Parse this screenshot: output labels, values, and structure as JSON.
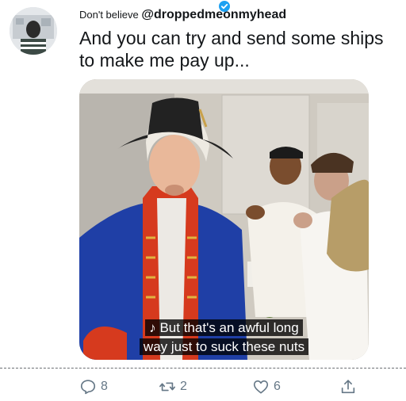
{
  "tweet": {
    "prefix": "Don't believe",
    "handle": "@droppedmeonmyhead",
    "text": "And you can try and send some ships to make me pay up..."
  },
  "video": {
    "caption_line1": "♪ But that's an awful long",
    "caption_line2": "way just to suck these nuts"
  },
  "actions": {
    "reply_count": "8",
    "retweet_count": "2",
    "like_count": "6"
  },
  "colors": {
    "verified": "#1da1f2",
    "icon_gray": "#657786",
    "coat_blue": "#1f3fa6",
    "coat_red": "#d63a1e"
  },
  "icons": [
    "verified-badge-icon",
    "reply-icon",
    "retweet-icon",
    "like-icon",
    "share-icon"
  ]
}
